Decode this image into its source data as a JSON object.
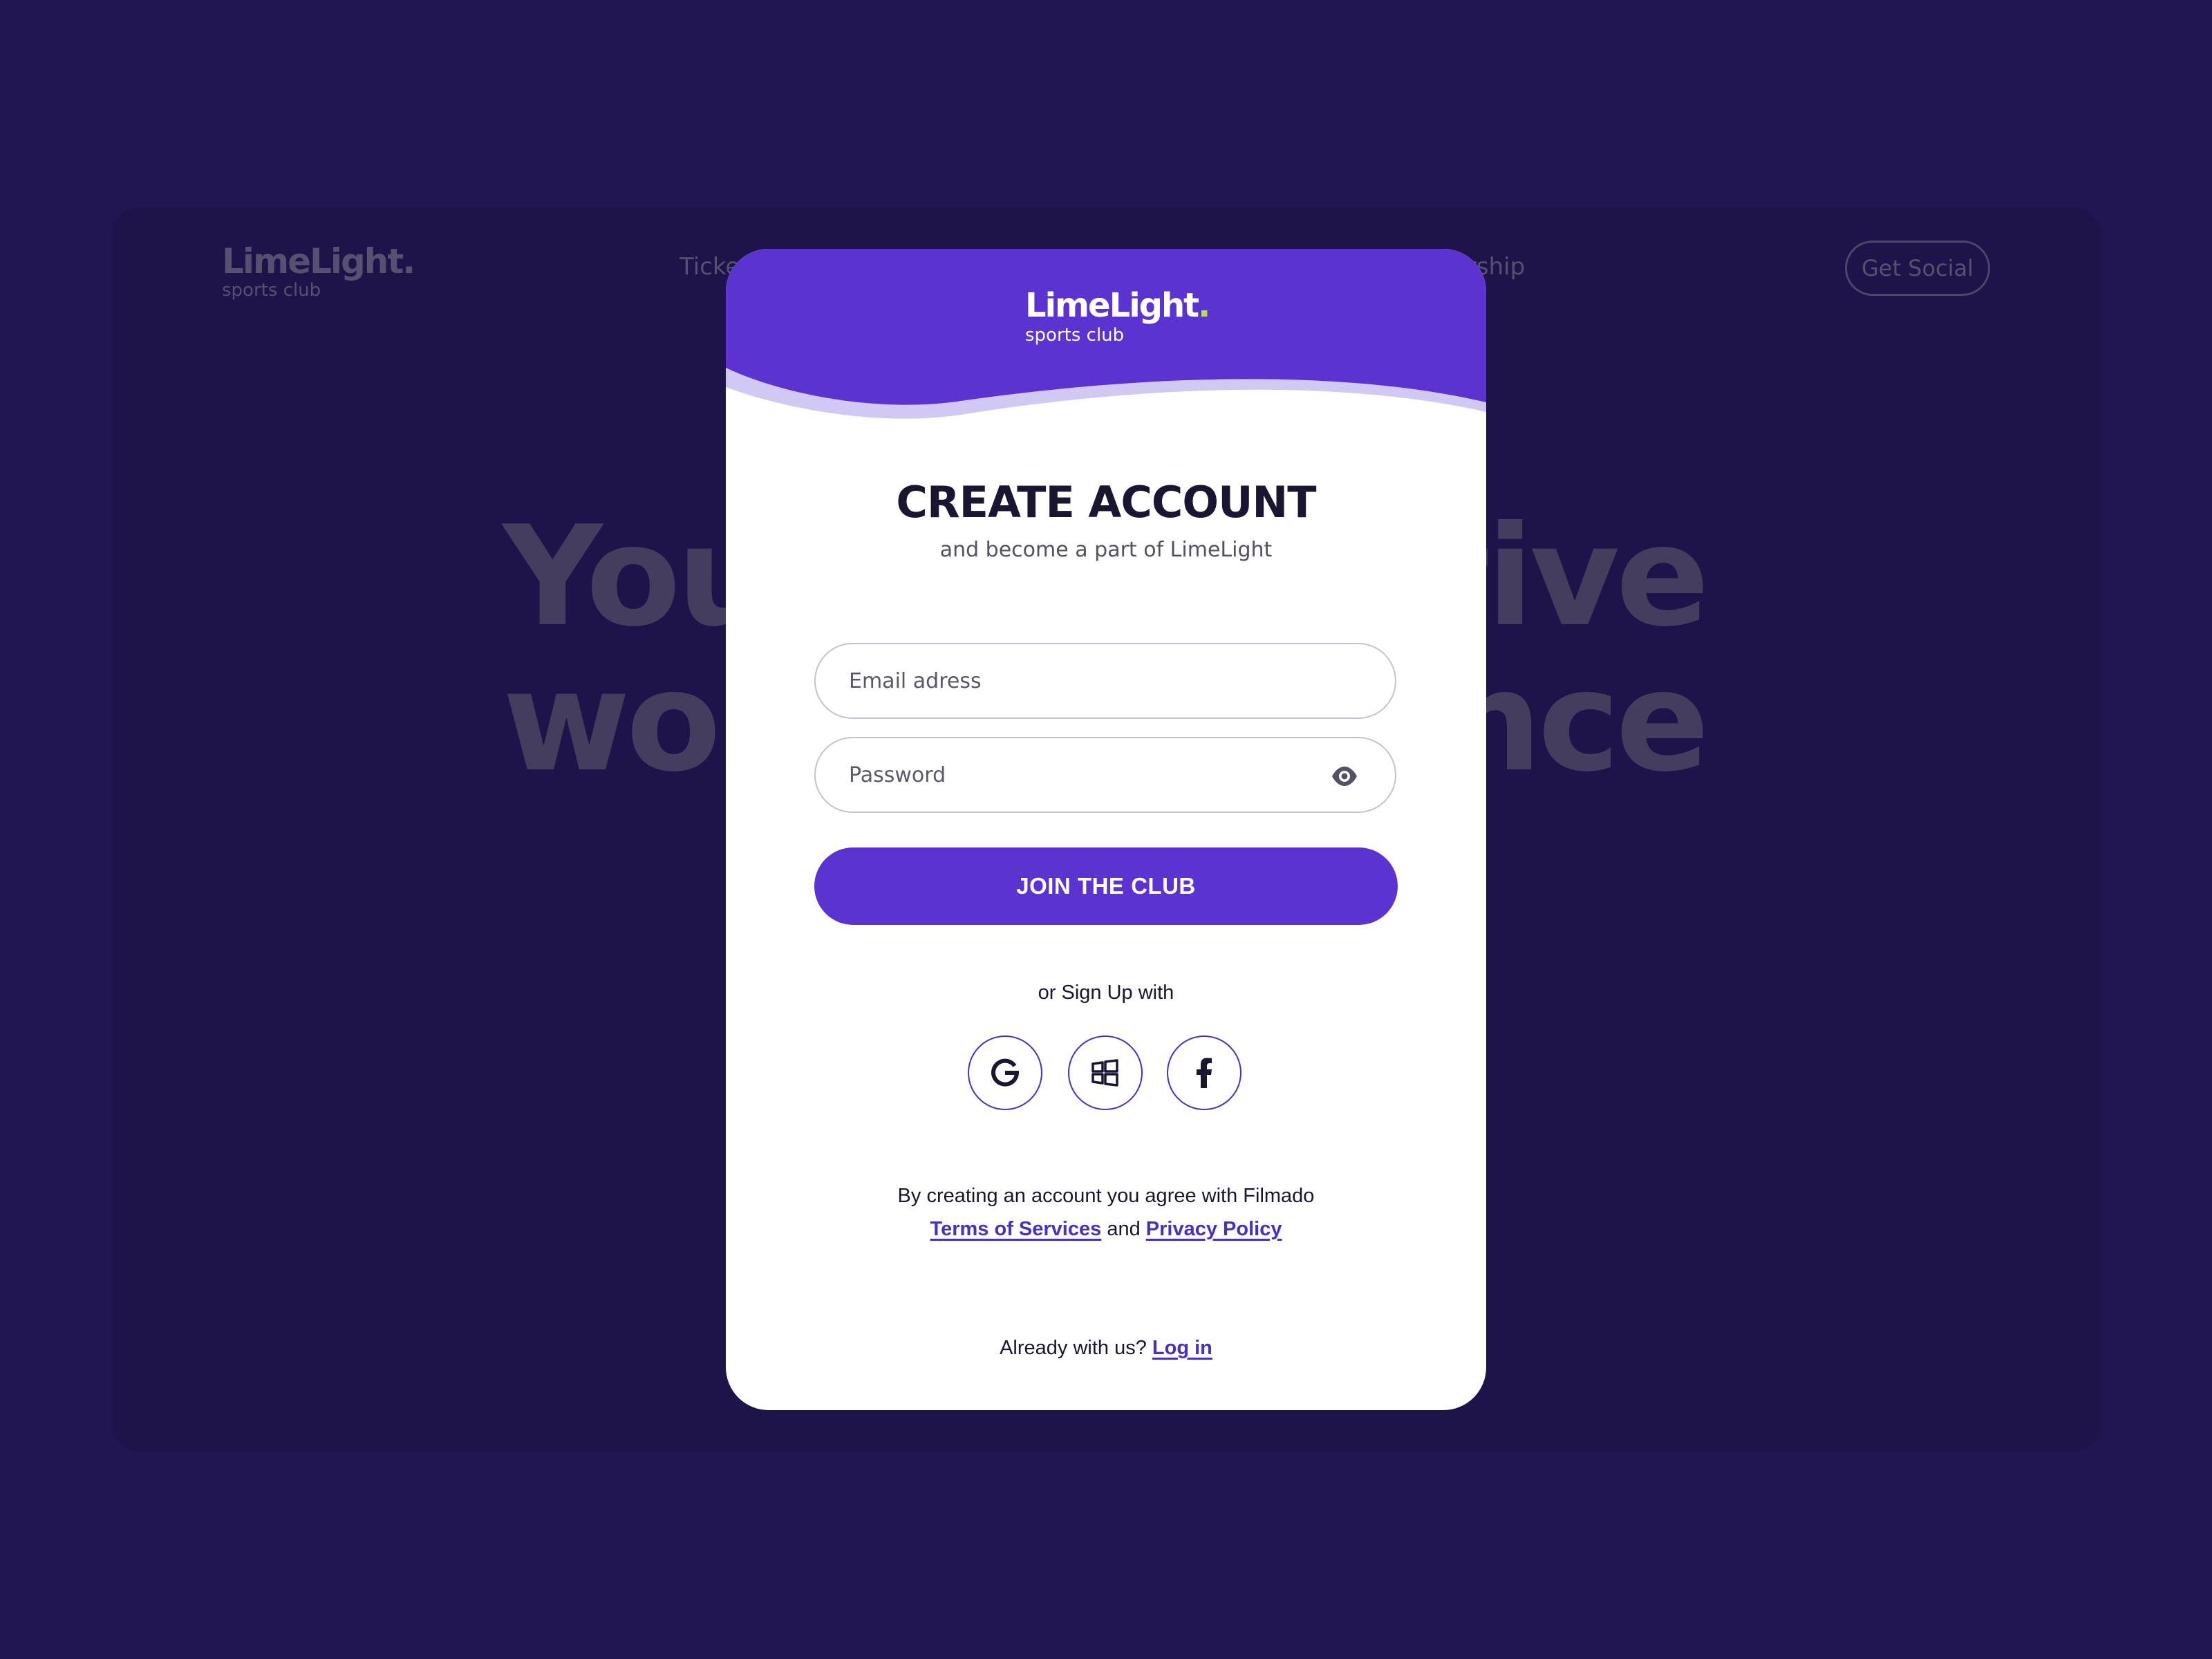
{
  "background": {
    "logo_name": "LimeLight",
    "logo_dot": ".",
    "logo_sub": "sports club",
    "nav_left_partial": "Ticke",
    "nav_right_partial": "ership",
    "social_button": "Get Social",
    "hero_line1_left": "You",
    "hero_line1_right": "tive",
    "hero_line2_left": "wor",
    "hero_line2_right": "nce"
  },
  "modal": {
    "logo_name": "LimeLight",
    "logo_dot": ".",
    "logo_sub": "sports club",
    "title": "CREATE ACCOUNT",
    "subtitle": "and become a part of LimeLight",
    "email_placeholder": "Email adress",
    "password_placeholder": "Password",
    "join_label": "JOIN THE CLUB",
    "or_text": "or Sign Up with",
    "social": [
      {
        "name": "google",
        "icon": "google-icon"
      },
      {
        "name": "windows",
        "icon": "windows-icon"
      },
      {
        "name": "facebook",
        "icon": "facebook-icon"
      }
    ],
    "terms_prefix": "By creating an account you agree with Filmado",
    "terms_link": "Terms of Services",
    "terms_and": "and",
    "privacy_link": "Privacy Policy",
    "already_text": "Already with us?",
    "login_link": "Log in"
  },
  "colors": {
    "page_bg": "#221552",
    "accent": "#5b33d1",
    "wave_light": "#d2c8f4",
    "lime_dot": "#b7e23a",
    "link": "#4a2fc0"
  }
}
